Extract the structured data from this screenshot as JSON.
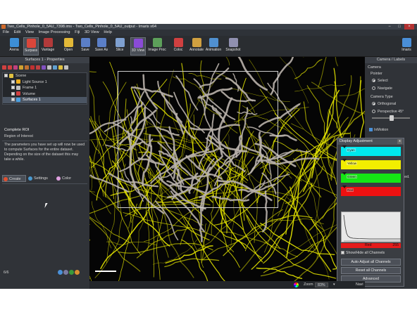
{
  "window": {
    "title": "Two_Cells_Pinhole_0_5AU_7398.ims - Two_Cells_Pinhole_0_5AU_output - Imaris x64",
    "minimize": "−",
    "maximize": "□",
    "close": "×"
  },
  "menu": [
    "File",
    "Edit",
    "View",
    "Image Processing",
    "Fiji",
    "3D View",
    "Help"
  ],
  "toolbar": {
    "items": [
      {
        "label": "Arena",
        "icon": "arena-icon",
        "color": "#3d8fd6"
      },
      {
        "label": "Surpass",
        "icon": "surpass-icon",
        "color": "#d9463a"
      },
      {
        "label": "Vantage",
        "icon": "vantage-icon",
        "color": "#b23a3a"
      },
      {
        "label": "Open",
        "icon": "open-folder-icon",
        "color": "#e2b838"
      },
      {
        "label": "Save",
        "icon": "save-disk-icon",
        "color": "#5b7fc7"
      },
      {
        "label": "Save As",
        "icon": "save-as-icon",
        "color": "#5b7fc7"
      },
      {
        "label": "Slice",
        "icon": "slice-icon",
        "color": "#7fa0d0"
      },
      {
        "label": "3D View",
        "icon": "3d-view-icon",
        "color": "#8a4bd6"
      },
      {
        "label": "Image Proc",
        "icon": "image-proc-icon",
        "color": "#5da05a"
      },
      {
        "label": "Coloc",
        "icon": "coloc-icon",
        "color": "#d04040"
      },
      {
        "label": "Annotate",
        "icon": "annotate-icon",
        "color": "#d0a040"
      },
      {
        "label": "Animation",
        "icon": "animation-icon",
        "color": "#5090d0"
      },
      {
        "label": "Snapshot",
        "icon": "snapshot-icon",
        "color": "#9090b0"
      },
      {
        "label": "Imaris",
        "icon": "imaris-logo-icon",
        "color": "#4a8fd8"
      }
    ]
  },
  "left_panel": {
    "header": "Surfaces 1 - Properties",
    "toolbar_icons": [
      "#d04040",
      "#d04040",
      "#c04080",
      "#d0a030",
      "#c07030",
      "#c03030",
      "#c04040",
      "#8050c0",
      "#c0c0c0",
      "#60a0d0",
      "#e0c040",
      "#c0c0c0"
    ],
    "tree": [
      {
        "label": "Scene",
        "color": "#e0c040"
      },
      {
        "label": "Light Source 1",
        "color": "#f0b020"
      },
      {
        "label": "Frame 1",
        "color": "#c0c0c0"
      },
      {
        "label": "Volume",
        "color": "#d04040"
      },
      {
        "label": "Surfaces 1",
        "color": "#4aa0e0",
        "selected": true
      }
    ],
    "tabs": [
      {
        "label": "Create",
        "color": "#e05030",
        "active": true
      },
      {
        "label": "Settings",
        "color": "#4a9ad0"
      },
      {
        "label": "Color",
        "color": "#e0a0e0"
      }
    ],
    "section_title": "Complete ROI",
    "section_sub": "Region of Interest",
    "description": [
      "The parameters you have set up will now be used",
      "to compute Surfaces for the entire dataset.",
      "Depending on the size of the dataset this may",
      "take a while."
    ],
    "step": "6/6",
    "footer_dots": [
      "#4a90d9",
      "#7a7aa0",
      "#3a9a3a",
      "#d99030"
    ]
  },
  "right_panel": {
    "header": "Camera / Labels",
    "camera": "Camera",
    "pointer": "Pointer",
    "select": "Select",
    "navigate": "Navigate",
    "camera_type": "Camera Type",
    "orthogonal": "Orthogonal",
    "perspective": "Perspective 45°",
    "inmotion": "InMotion",
    "partial": "cted."
  },
  "display_adjustment": {
    "title": "Display Adjustment",
    "close": "x",
    "channels": [
      {
        "label": "Cyan",
        "color": "#00e8ee"
      },
      {
        "label": "Yellow",
        "color": "#f2ee00"
      },
      {
        "label": "Green",
        "color": "#15e615"
      },
      {
        "label": "Red",
        "color": "#ee1111"
      }
    ],
    "red_bar_label": "Red",
    "red_bar_value": "255",
    "show_hide": "Show/Hide all Channels",
    "auto_adjust": "Auto Adjust all Channels",
    "reset": "Reset all Channels",
    "advanced": "Advanced"
  },
  "status": {
    "zoom_label": "Zoom",
    "zoom_value": "83%",
    "right_text": "Navi"
  },
  "viewport": {
    "background": "#050505",
    "filament_color": "#e8e800",
    "surface_color": "#b9b1ab"
  }
}
